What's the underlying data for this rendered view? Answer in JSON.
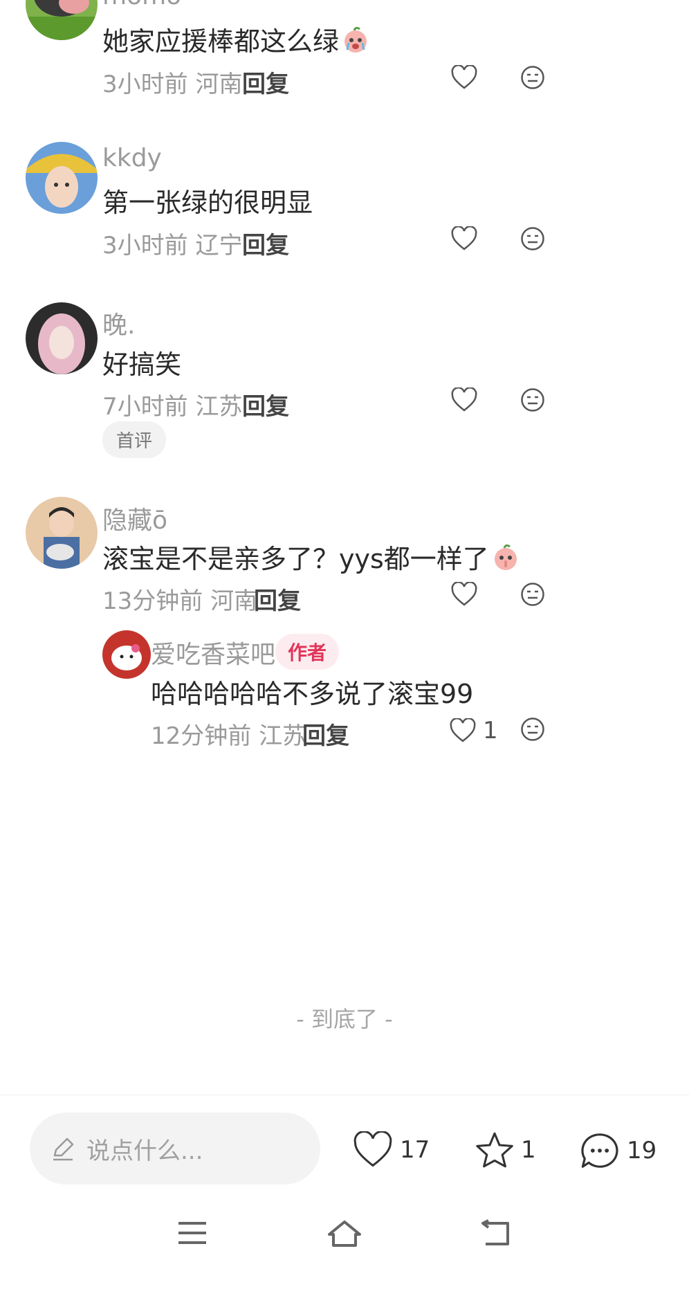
{
  "comments": [
    {
      "username": "momo",
      "content": "她家应援棒都这么绿",
      "time": "3小时前",
      "location": "河南",
      "reply_label": "回复",
      "emoji": "crying-peach-emoji"
    },
    {
      "username": "kkdy",
      "content": "第一张绿的很明显",
      "time": "3小时前",
      "location": "辽宁",
      "reply_label": "回复"
    },
    {
      "username": "晚.",
      "content": "好搞笑",
      "time": "7小时前",
      "location": "江苏",
      "reply_label": "回复",
      "badge": "首评"
    },
    {
      "username": "隐藏ō",
      "content": "滚宝是不是亲多了？yys都一样了",
      "time": "13分钟前",
      "location": "河南",
      "reply_label": "回复",
      "emoji": "shushing-peach-emoji",
      "replies": [
        {
          "username": "爱吃香菜吧",
          "author_badge": "作者",
          "content": "哈哈哈哈哈不多说了滚宝99",
          "time": "12分钟前",
          "location": "江苏",
          "reply_label": "回复",
          "likes": "1"
        }
      ]
    }
  ],
  "end_text": "- 到底了 -",
  "bottom_bar": {
    "input_placeholder": "说点什么...",
    "like_count": "17",
    "star_count": "1",
    "comment_count": "19"
  },
  "colors": {
    "author_badge_bg": "#fdecef",
    "author_badge_text": "#e2355a",
    "meta_gray": "#9a9a9a"
  }
}
